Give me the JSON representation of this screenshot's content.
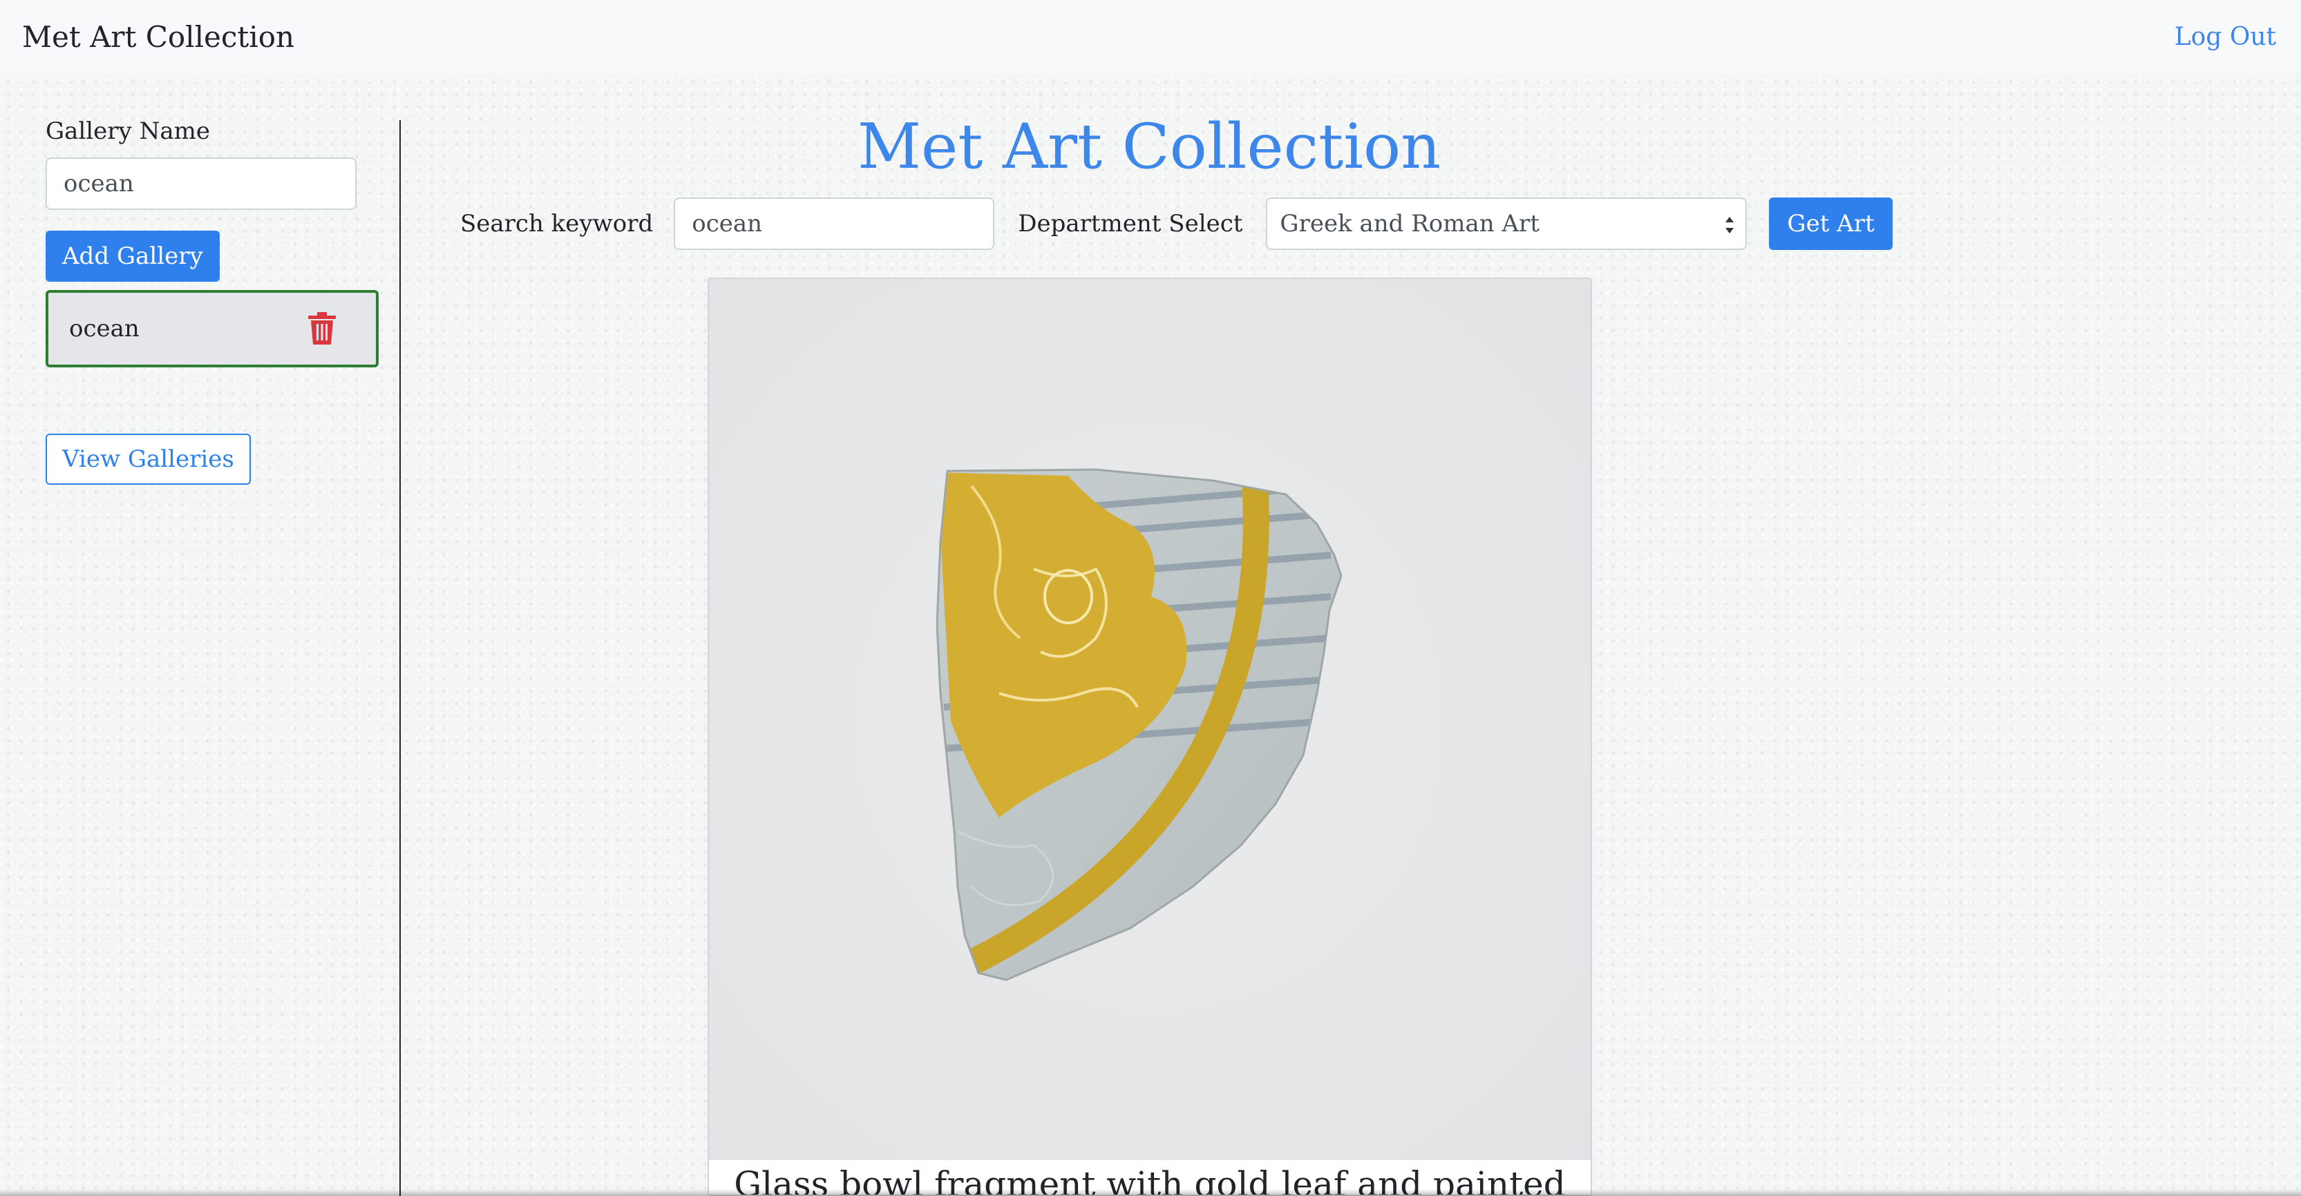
{
  "navbar": {
    "brand": "Met Art Collection",
    "logout_label": "Log Out"
  },
  "sidebar": {
    "gallery_name_label": "Gallery Name",
    "gallery_name_value": "ocean",
    "add_gallery_label": "Add Gallery",
    "galleries": [
      {
        "name": "ocean",
        "delete_icon": "trash-icon"
      }
    ],
    "view_galleries_label": "View Galleries"
  },
  "main": {
    "title": "Met Art Collection",
    "search_keyword_label": "Search keyword",
    "search_keyword_value": "ocean",
    "department_label": "Department Select",
    "department_selected": "Greek and Roman Art",
    "get_art_label": "Get Art"
  },
  "artwork": {
    "title": "Glass bowl fragment with gold leaf and painted"
  },
  "colors": {
    "accent": "#2f80ed",
    "title_blue": "#3d86ea",
    "delete_red": "#d9363e",
    "selected_border": "#2e7d32"
  }
}
